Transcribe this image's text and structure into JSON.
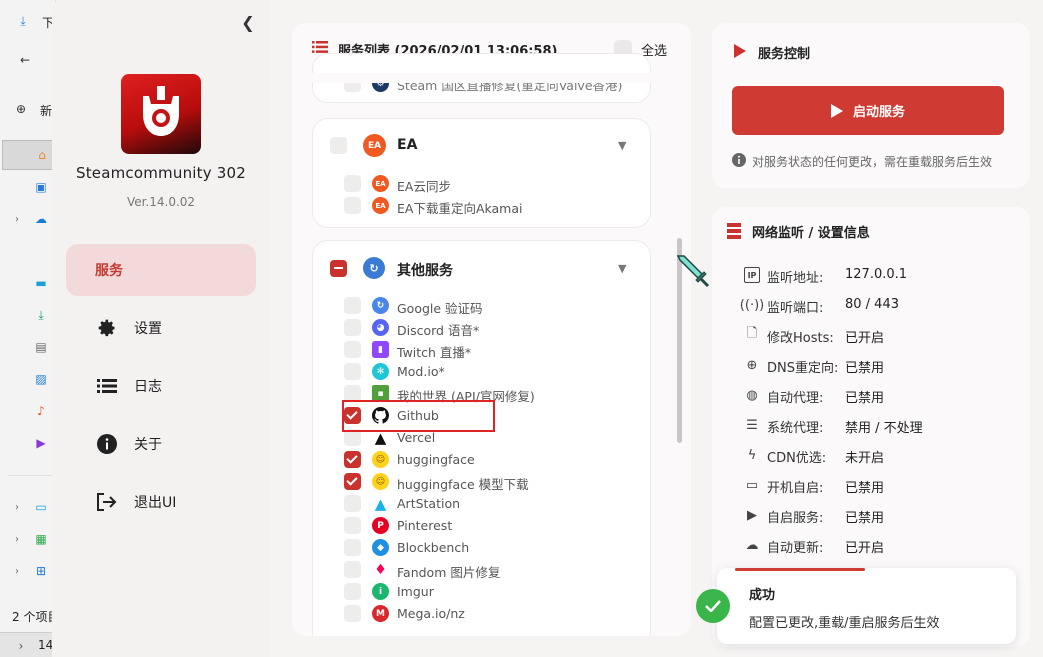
{
  "explorer": {
    "items": [
      "下",
      "新",
      "2 个项目",
      "14"
    ]
  },
  "app": {
    "name": "Steamcommunity 302",
    "version": "Ver.14.0.02"
  },
  "nav": {
    "service": "服务",
    "settings": "设置",
    "logs": "日志",
    "about": "关于",
    "exit": "退出UI"
  },
  "service_list": {
    "title": "服务列表 (2026/02/01 13:06:58)",
    "select_all": "全选",
    "steam_partial": "Steam 国区直播修复(重定向Valve香港)",
    "groups": [
      {
        "title": "EA",
        "items": [
          {
            "label": "EA云同步",
            "checked": false
          },
          {
            "label": "EA下载重定向Akamai",
            "checked": false
          }
        ]
      },
      {
        "title": "其他服务",
        "items": [
          {
            "label": "Google 验证码",
            "checked": false,
            "icon": "google-icon"
          },
          {
            "label": "Discord 语音*",
            "checked": false,
            "icon": "discord-icon"
          },
          {
            "label": "Twitch 直播*",
            "checked": false,
            "icon": "twitch-icon"
          },
          {
            "label": "Mod.io*",
            "checked": false,
            "icon": "modio-icon"
          },
          {
            "label": "我的世界 (API/官网修复)",
            "checked": false,
            "icon": "minecraft-icon"
          },
          {
            "label": "Github",
            "checked": true,
            "icon": "github-icon"
          },
          {
            "label": "Vercel",
            "checked": false,
            "icon": "vercel-icon"
          },
          {
            "label": "huggingface",
            "checked": true,
            "icon": "huggingface-icon"
          },
          {
            "label": "huggingface 模型下载",
            "checked": true,
            "icon": "huggingface-icon"
          },
          {
            "label": "ArtStation",
            "checked": false,
            "icon": "artstation-icon"
          },
          {
            "label": "Pinterest",
            "checked": false,
            "icon": "pinterest-icon"
          },
          {
            "label": "Blockbench",
            "checked": false,
            "icon": "blockbench-icon"
          },
          {
            "label": "Fandom 图片修复",
            "checked": false,
            "icon": "fandom-icon"
          },
          {
            "label": "Imgur",
            "checked": false,
            "icon": "imgur-icon"
          },
          {
            "label": "Mega.io/nz",
            "checked": false,
            "icon": "mega-icon"
          }
        ]
      }
    ]
  },
  "control": {
    "title": "服务控制",
    "start_button": "启动服务",
    "note": "对服务状态的任何更改，需在重载服务后生效"
  },
  "netinfo": {
    "title": "网络监听 / 设置信息",
    "rows": [
      {
        "key": "监听地址:",
        "value": "127.0.0.1",
        "icon": "ip-icon"
      },
      {
        "key": "监听端口:",
        "value": "80 / 443",
        "icon": "port-icon"
      },
      {
        "key": "修改Hosts:",
        "value": "已开启",
        "icon": "hosts-icon"
      },
      {
        "key": "DNS重定向:",
        "value": "已禁用",
        "icon": "dns-icon"
      },
      {
        "key": "自动代理:",
        "value": "已禁用",
        "icon": "globe-icon"
      },
      {
        "key": "系统代理:",
        "value": "禁用 / 不处理",
        "icon": "sliders-icon"
      },
      {
        "key": "CDN优选:",
        "value": "未开启",
        "icon": "bolt-icon"
      },
      {
        "key": "开机自启:",
        "value": "已禁用",
        "icon": "laptop-icon"
      },
      {
        "key": "自启服务:",
        "value": "已禁用",
        "icon": "play-circle-icon"
      },
      {
        "key": "自动更新:",
        "value": "已开启",
        "icon": "cloud-icon"
      }
    ]
  },
  "toast": {
    "title": "成功",
    "message": "配置已更改,重载/重启服务后生效"
  },
  "colors": {
    "accent": "#c9322d",
    "active_nav_bg": "#f2dada",
    "success": "#39b54a"
  }
}
